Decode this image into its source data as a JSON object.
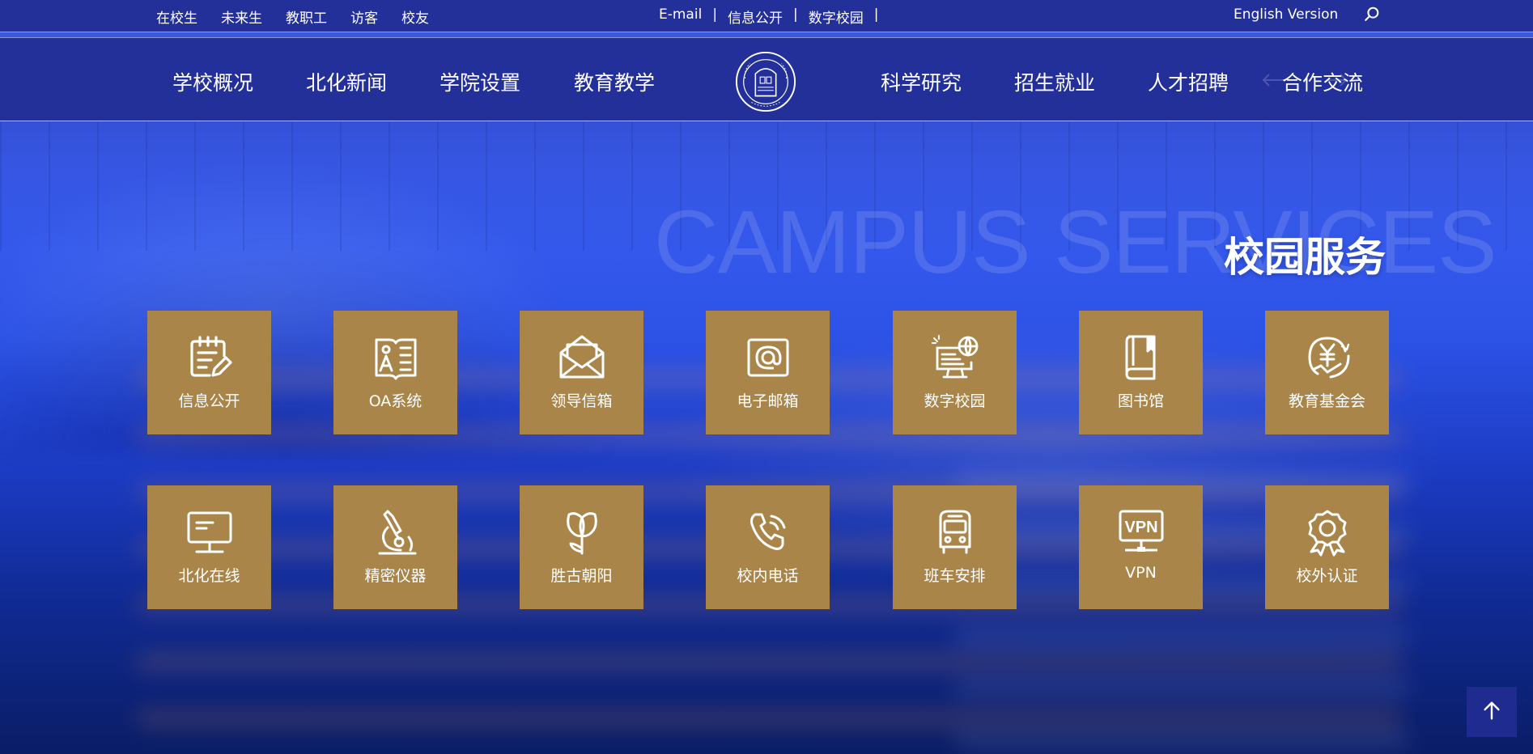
{
  "topbar": {
    "audience_links": [
      "在校生",
      "未来生",
      "教职工",
      "访客",
      "校友"
    ],
    "quick_links": [
      "E-mail",
      "信息公开",
      "数字校园"
    ],
    "separator": "|",
    "english": "English Version"
  },
  "nav": {
    "left": [
      "学校概况",
      "北化新闻",
      "学院设置",
      "教育教学"
    ],
    "right": [
      "科学研究",
      "招生就业",
      "人才招聘",
      "合作交流"
    ]
  },
  "section": {
    "watermark": "CAMPUS SERVICES",
    "title": "校园服务"
  },
  "services": [
    {
      "label": "信息公开",
      "icon": "clipboard-pen-icon"
    },
    {
      "label": "OA系统",
      "icon": "oa-document-icon"
    },
    {
      "label": "领导信箱",
      "icon": "open-envelope-icon"
    },
    {
      "label": "电子邮箱",
      "icon": "at-sign-icon"
    },
    {
      "label": "数字校园",
      "icon": "globe-monitor-icon"
    },
    {
      "label": "图书馆",
      "icon": "book-icon"
    },
    {
      "label": "教育基金会",
      "icon": "yen-hand-icon"
    },
    {
      "label": "北化在线",
      "icon": "monitor-icon"
    },
    {
      "label": "精密仪器",
      "icon": "microscope-icon"
    },
    {
      "label": "胜古朝阳",
      "icon": "tulip-icon"
    },
    {
      "label": "校内电话",
      "icon": "phone-icon"
    },
    {
      "label": "班车安排",
      "icon": "bus-icon"
    },
    {
      "label": "VPN",
      "icon": "vpn-icon",
      "icon_text": "VPN"
    },
    {
      "label": "校外认证",
      "icon": "award-badge-icon"
    }
  ],
  "colors": {
    "bar": "#24309a",
    "tile": "#a9854a",
    "backtop": "#1f2b8e"
  }
}
